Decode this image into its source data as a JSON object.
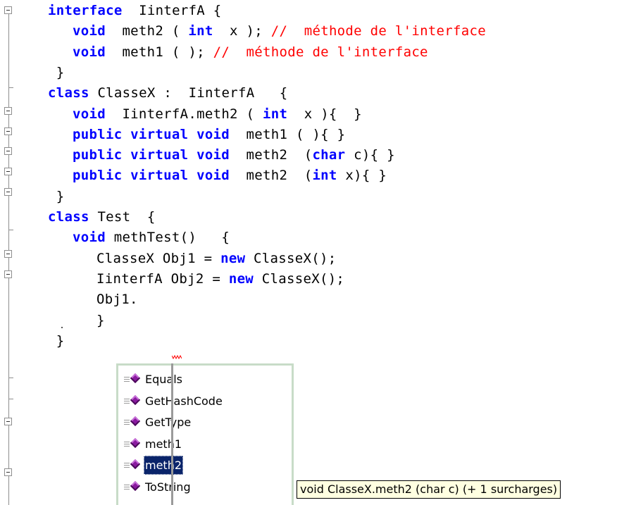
{
  "code": {
    "lines": [
      {
        "indent": 2,
        "tokens": [
          {
            "t": "interface",
            "c": "kw"
          },
          {
            "t": "  IinterfA {"
          }
        ]
      },
      {
        "indent": 3,
        "tokens": [
          {
            "t": "void",
            "c": "kw"
          },
          {
            "t": "  meth2 ( "
          },
          {
            "t": "int",
            "c": "kw"
          },
          {
            "t": "  x ); "
          },
          {
            "t": "//  méthode de l'interface",
            "c": "cm"
          }
        ]
      },
      {
        "indent": 3,
        "tokens": [
          {
            "t": "void",
            "c": "kw"
          },
          {
            "t": "  meth1 ( ); "
          },
          {
            "t": "//  méthode de l'interface",
            "c": "cm"
          }
        ]
      },
      {
        "indent": 2,
        "tokens": [
          {
            "t": " }"
          }
        ]
      },
      {
        "indent": 2,
        "tokens": [
          {
            "t": "class",
            "c": "kw"
          },
          {
            "t": " ClasseX :  IinterfA   {"
          }
        ]
      },
      {
        "indent": 3,
        "tokens": [
          {
            "t": "void",
            "c": "kw"
          },
          {
            "t": "  IinterfA.meth2 ( "
          },
          {
            "t": "int",
            "c": "kw"
          },
          {
            "t": "  x ){  }"
          }
        ]
      },
      {
        "indent": 3,
        "tokens": [
          {
            "t": "public virtual void",
            "c": "kw"
          },
          {
            "t": "  meth1 ( ){ }"
          }
        ]
      },
      {
        "indent": 3,
        "tokens": [
          {
            "t": "public virtual void",
            "c": "kw"
          },
          {
            "t": "  meth2  ("
          },
          {
            "t": "char",
            "c": "kw"
          },
          {
            "t": " c){ }"
          }
        ]
      },
      {
        "indent": 3,
        "tokens": [
          {
            "t": "public virtual void",
            "c": "kw"
          },
          {
            "t": "  meth2  ("
          },
          {
            "t": "int",
            "c": "kw"
          },
          {
            "t": " x){ }"
          }
        ]
      },
      {
        "indent": 2,
        "tokens": [
          {
            "t": " }"
          }
        ]
      },
      {
        "indent": 2,
        "tokens": [
          {
            "t": "class",
            "c": "kw"
          },
          {
            "t": " Test  {"
          }
        ]
      },
      {
        "indent": 3,
        "tokens": [
          {
            "t": "void",
            "c": "kw"
          },
          {
            "t": " methTest()   {"
          }
        ]
      },
      {
        "indent": 4,
        "tokens": [
          {
            "t": "ClasseX Obj1 = "
          },
          {
            "t": "new",
            "c": "kw"
          },
          {
            "t": " ClasseX();"
          }
        ]
      },
      {
        "indent": 4,
        "tokens": [
          {
            "t": "IinterfA Obj2 = "
          },
          {
            "t": "new",
            "c": "kw"
          },
          {
            "t": " ClasseX();"
          }
        ]
      },
      {
        "indent": 4,
        "tokens": [
          {
            "t": "Obj1."
          }
        ]
      },
      {
        "indent": 4,
        "tokens": [
          {
            "t": "}"
          }
        ]
      },
      {
        "indent": 2,
        "tokens": [
          {
            "t": " }"
          }
        ]
      }
    ]
  },
  "completion": {
    "items": [
      {
        "label": "Equals",
        "icon": "method-icon",
        "selected": false
      },
      {
        "label": "GetHashCode",
        "icon": "method-icon",
        "selected": false
      },
      {
        "label": "GetType",
        "icon": "method-icon",
        "selected": false
      },
      {
        "label": "meth1",
        "icon": "method-icon",
        "selected": false
      },
      {
        "label": "meth2",
        "icon": "method-icon",
        "selected": true
      },
      {
        "label": "ToString",
        "icon": "method-icon",
        "selected": false
      }
    ]
  },
  "tooltip": {
    "text": "void ClasseX.meth2 (char c) (+ 1 surcharges)"
  },
  "colors": {
    "keyword": "#0000ff",
    "comment": "#ff0000",
    "selection": "#0a246a",
    "tooltip_bg": "#ffffe1",
    "method_icon": "#8a1aa0"
  }
}
